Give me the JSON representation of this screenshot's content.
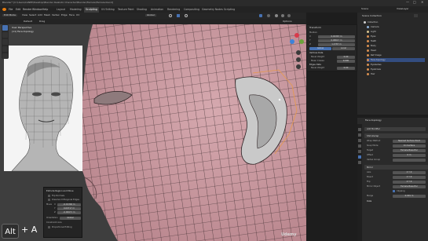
{
  "titlebar": {
    "title": "Blender* [C:\\Users\\CANEE\\Desktop\\Blender Realistic Character\\Blender\\Female\\Female.blend]"
  },
  "menubar": {
    "items": [
      "File",
      "Edit",
      "Render",
      "Window",
      "Help"
    ],
    "workspaces": [
      "Layout",
      "Modeling",
      "Sculpting",
      "UV Editing",
      "Texture Paint",
      "Shading",
      "Animation",
      "Rendering",
      "Compositing",
      "Geometry Nodes",
      "Scripting"
    ],
    "active_workspace": "Sculpting",
    "scene_label": "Scene",
    "viewlayer_label": "ViewLayer"
  },
  "header3d": {
    "mode": "Edit Mode",
    "menus": [
      "View",
      "Select",
      "Add",
      "Mesh",
      "Vertex",
      "Edge",
      "Face",
      "UV"
    ],
    "transform": "Global",
    "orientation": "Default",
    "drag": "Drag",
    "options": "Options"
  },
  "viewport": {
    "overlay_title": "User Perspective",
    "overlay_subtitle": "(11) Face.topology",
    "watermark": "Udemy"
  },
  "n_panel": {
    "title": "Transform",
    "rows": [
      {
        "label": "Median:",
        "value": ""
      },
      {
        "label": "X",
        "value": "0.02367 m"
      },
      {
        "label": "Y",
        "value": "0.08017 m"
      },
      {
        "label": "Z",
        "value": "1.4787 m"
      }
    ],
    "toggle_global": "Global",
    "toggle_local": "Local",
    "section2": "Vertices Data",
    "data_rows": [
      {
        "label": "Bevel Weight",
        "value": "0.00"
      },
      {
        "label": "Mean Crease",
        "value": "0.000"
      }
    ],
    "section3": "Edges Data",
    "edge_rows": [
      {
        "label": "Bevel Weight",
        "value": "0.00"
      },
      {
        "label": "Crease",
        "value": "0.00"
      }
    ]
  },
  "outliner": {
    "title": "Scene Collection",
    "items": [
      {
        "name": "Collection",
        "color": "#d0d0d0"
      },
      {
        "name": "Camera",
        "color": "#8fb3d9"
      },
      {
        "name": "Light",
        "color": "#d9c58f"
      },
      {
        "name": "Eyes",
        "color": "#d98f50"
      },
      {
        "name": "Teeth",
        "color": "#d98f50"
      },
      {
        "name": "Body",
        "color": "#d98f50"
      },
      {
        "name": "Head",
        "color": "#d98f50"
      },
      {
        "name": "Ref Image",
        "color": "#d98f50"
      },
      {
        "name": "Face.topology",
        "color": "#d98f50"
      },
      {
        "name": "Eyelashes",
        "color": "#d98f50"
      },
      {
        "name": "Eyebrows",
        "color": "#d98f50"
      },
      {
        "name": "Hair",
        "color": "#d98f50"
      }
    ]
  },
  "properties": {
    "object_name": "Face.topology",
    "add_modifier": "Add Modifier",
    "modifiers": [
      {
        "name": "Shrinkwrap",
        "rows": [
          {
            "label": "Wrap Method",
            "value": "Nearest Surface Point"
          },
          {
            "label": "Snap Mode",
            "value": "On Surface"
          },
          {
            "label": "Target",
            "value": "Female.Base.Ear"
          },
          {
            "label": "Offset",
            "value": "0 m"
          },
          {
            "label": "Vertex Group",
            "value": ""
          }
        ]
      },
      {
        "name": "Mirror",
        "rows": [
          {
            "label": "Axis",
            "value": "X  Y  Z"
          },
          {
            "label": "Bisect",
            "value": "X  Y  Z"
          },
          {
            "label": "Flip",
            "value": "X  Y  Z"
          },
          {
            "label": "Mirror Object",
            "value": "Female.Base.Ear"
          },
          {
            "label": "Clipping",
            "value": ""
          },
          {
            "label": "Merge",
            "value": "0.001 m"
          }
        ]
      }
    ],
    "data_label": "Data"
  },
  "redo_panel": {
    "title": "Extrude Region and Move",
    "flip_normals": "Flip Normals",
    "dissolve": "Dissolve Orthogonal Edges",
    "move_label": "Move",
    "move": [
      "X",
      "Y",
      "Z"
    ],
    "move_values": [
      "-0.01340 m",
      "0.00717 m",
      "-0.00671 m"
    ],
    "orientation_label": "Orientation",
    "orientation_value": "Global",
    "constraint_label": "Constraint Axis",
    "proportional": "Proportional Editing"
  },
  "keys": {
    "modifier": "Alt",
    "plus": "+",
    "key": "A"
  },
  "colors": {
    "skin": "#c7969d",
    "mesh_wire": "#1f1a1b",
    "accent": "#4772b3"
  }
}
